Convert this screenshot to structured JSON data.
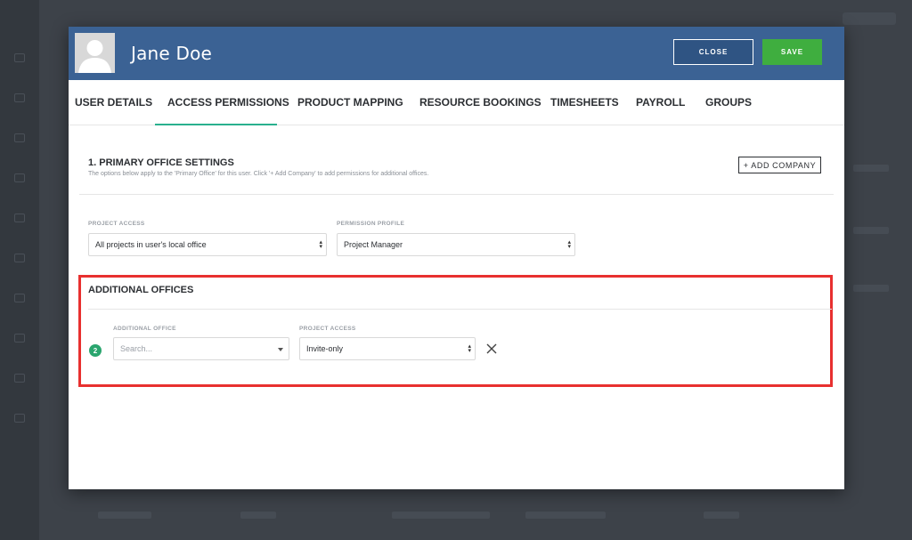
{
  "user": {
    "name": "Jane Doe"
  },
  "header": {
    "close_label": "CLOSE",
    "save_label": "SAVE"
  },
  "tabs": [
    {
      "label": "USER DETAILS"
    },
    {
      "label": "ACCESS PERMISSIONS",
      "active": true
    },
    {
      "label": "PRODUCT MAPPING"
    },
    {
      "label": "RESOURCE BOOKINGS"
    },
    {
      "label": "TIMESHEETS"
    },
    {
      "label": "PAYROLL"
    },
    {
      "label": "GROUPS"
    }
  ],
  "primary_office": {
    "title": "1. PRIMARY OFFICE SETTINGS",
    "description": "The options below apply to the 'Primary Office' for this user. Click '+ Add Company' to add permissions for additional offices.",
    "add_company_label": "+ ADD COMPANY",
    "project_access": {
      "label": "PROJECT ACCESS",
      "value": "All projects in user's local office"
    },
    "permission_profile": {
      "label": "PERMISSION PROFILE",
      "value": "Project Manager"
    }
  },
  "additional_offices": {
    "title": "ADDITIONAL OFFICES",
    "rows": [
      {
        "number": "2",
        "office_label": "ADDITIONAL OFFICE",
        "office_placeholder": "Search...",
        "access_label": "PROJECT ACCESS",
        "access_value": "Invite-only"
      }
    ]
  },
  "colors": {
    "header_bg": "#3b6294",
    "save_green": "#3fae3f",
    "tab_active_underline": "#29b08e",
    "highlight_red": "#e8302f",
    "badge_green": "#2aa56e"
  },
  "icons": {
    "avatar": "user-silhouette-icon",
    "remove": "close-x-icon",
    "select": "updown-arrows-icon",
    "dropdown": "caret-down-icon"
  }
}
